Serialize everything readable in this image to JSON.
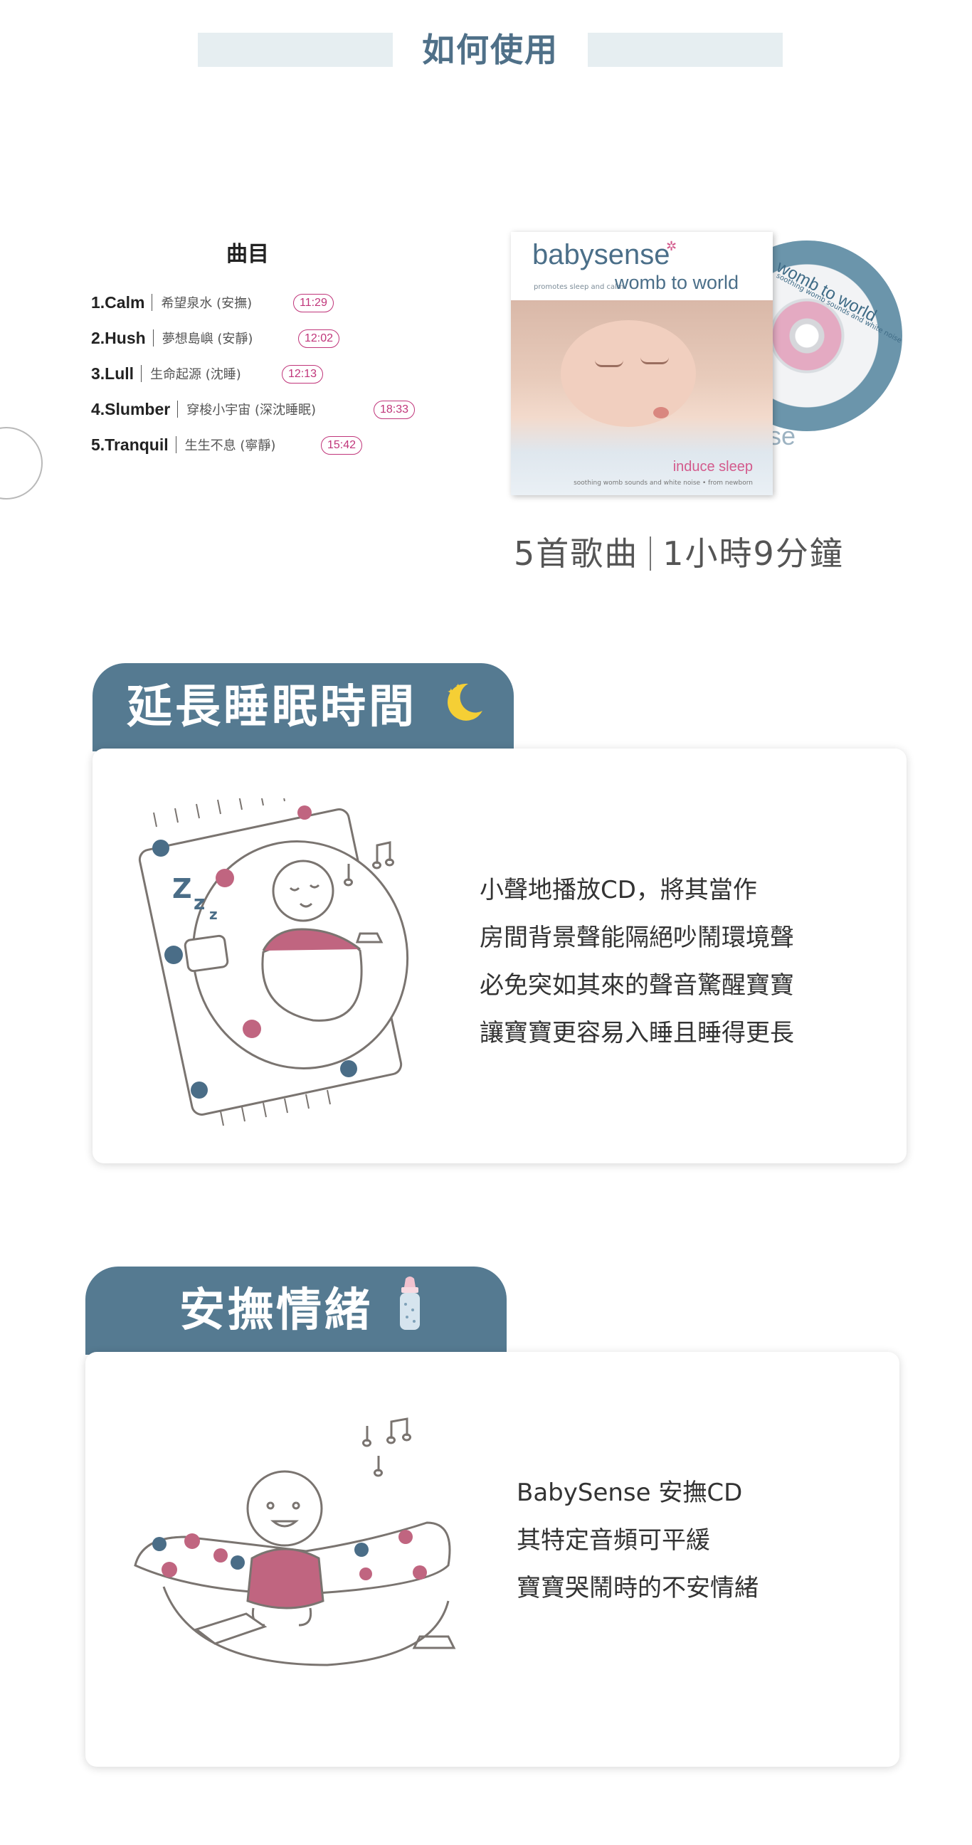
{
  "header": {
    "title": "如何使用"
  },
  "tracklist": {
    "title": "曲目",
    "tracks": [
      {
        "name": "1.Calm",
        "desc": "希望泉水 (安撫)",
        "duration": "11:29"
      },
      {
        "name": "2.Hush",
        "desc": "夢想島嶼 (安靜)",
        "duration": "12:02"
      },
      {
        "name": "3.Lull",
        "desc": "生命起源 (沈睡)",
        "duration": "12:13"
      },
      {
        "name": "4.Slumber",
        "desc": "穿梭小宇宙 (深沈睡眠)",
        "duration": "18:33"
      },
      {
        "name": "5.Tranquil",
        "desc": "生生不息 (寧靜)",
        "duration": "15:42"
      }
    ]
  },
  "product": {
    "brand": "babysense",
    "tagline": "promotes sleep and calm",
    "album": "womb to world",
    "cd_label": "womb to world",
    "cd_sub": "soothing womb sounds and white noise",
    "cd_brand_fragment": "se",
    "subtitle": "induce sleep",
    "fineprint": "soothing womb sounds and white noise  •  from newborn"
  },
  "summary": {
    "songs": "5首歌曲",
    "length": "1小時9分鐘"
  },
  "features": [
    {
      "title": "延長睡眠時間",
      "icon": "crescent-moon-icon",
      "lines": [
        "小聲地播放CD，將其當作",
        "房間背景聲能隔絕吵鬧環境聲",
        "必免突如其來的聲音驚醒寶寶",
        "讓寶寶更容易入睡且睡得更長"
      ]
    },
    {
      "title": "安撫情緒",
      "icon": "baby-bottle-icon",
      "lines": [
        "BabySense 安撫CD",
        "其特定音頻可平緩",
        "寶寶哭鬧時的不安情緒"
      ]
    }
  ],
  "colors": {
    "accent": "#557a91",
    "title": "#4f7088",
    "duration": "#c0357a",
    "header_bar": "#e6eef1",
    "dot_pink": "#c06580",
    "dot_blue": "#4a6d87"
  }
}
